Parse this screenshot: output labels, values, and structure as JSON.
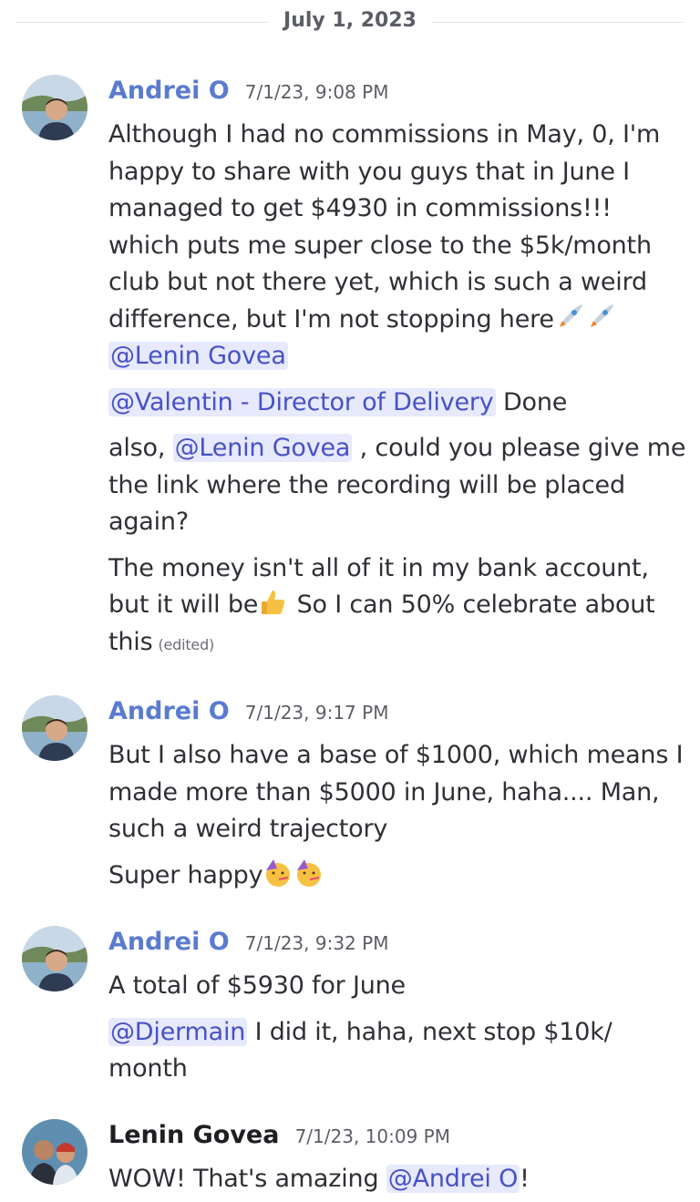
{
  "date_divider": "July 1, 2023",
  "groups": [
    {
      "author": "Andrei O",
      "timestamp": "7/1/23, 9:08 PM",
      "messages": [
        {
          "text1": "Although I had no commissions in May, 0, I'm happy to share with you guys that in June I managed to get $4930 in commissions!!! which puts me super close to the $5k/month club but not there yet, which is such a weird difference, but I'm not stopping here",
          "emoji": "rocket-emoji",
          "mention": "@Lenin Govea"
        },
        {
          "mention": "@Valentin - Director of Delivery",
          "text": " Done"
        },
        {
          "pre": "also, ",
          "mention": "@Lenin Govea",
          "text": " , could you please give me the link where the recording will be placed again?"
        },
        {
          "text1": "The money isn't all of it in my bank account, but it will be",
          "emoji": "thumbs-up-emoji",
          "text2": " So I can 50% celebrate about this",
          "edited": "(edited)"
        }
      ]
    },
    {
      "author": "Andrei O",
      "timestamp": "7/1/23, 9:17 PM",
      "messages": [
        {
          "text": "But I also have a base of $1000, which means I made more than $5000 in June, haha.... Man, such a weird trajectory"
        },
        {
          "text": "Super happy",
          "emoji": "partying-face-emoji"
        }
      ]
    },
    {
      "author": "Andrei O",
      "timestamp": "7/1/23, 9:32 PM",
      "messages": [
        {
          "text": "A total of $5930 for June"
        },
        {
          "mention": "@Djermain",
          "text": " I did it, haha, next stop $10k/ month"
        }
      ]
    },
    {
      "author": "Lenin Govea",
      "timestamp": "7/1/23, 10:09 PM",
      "messages": [
        {
          "pre": "WOW! That's amazing ",
          "mention": "@Andrei O",
          "text": "!"
        }
      ]
    }
  ]
}
